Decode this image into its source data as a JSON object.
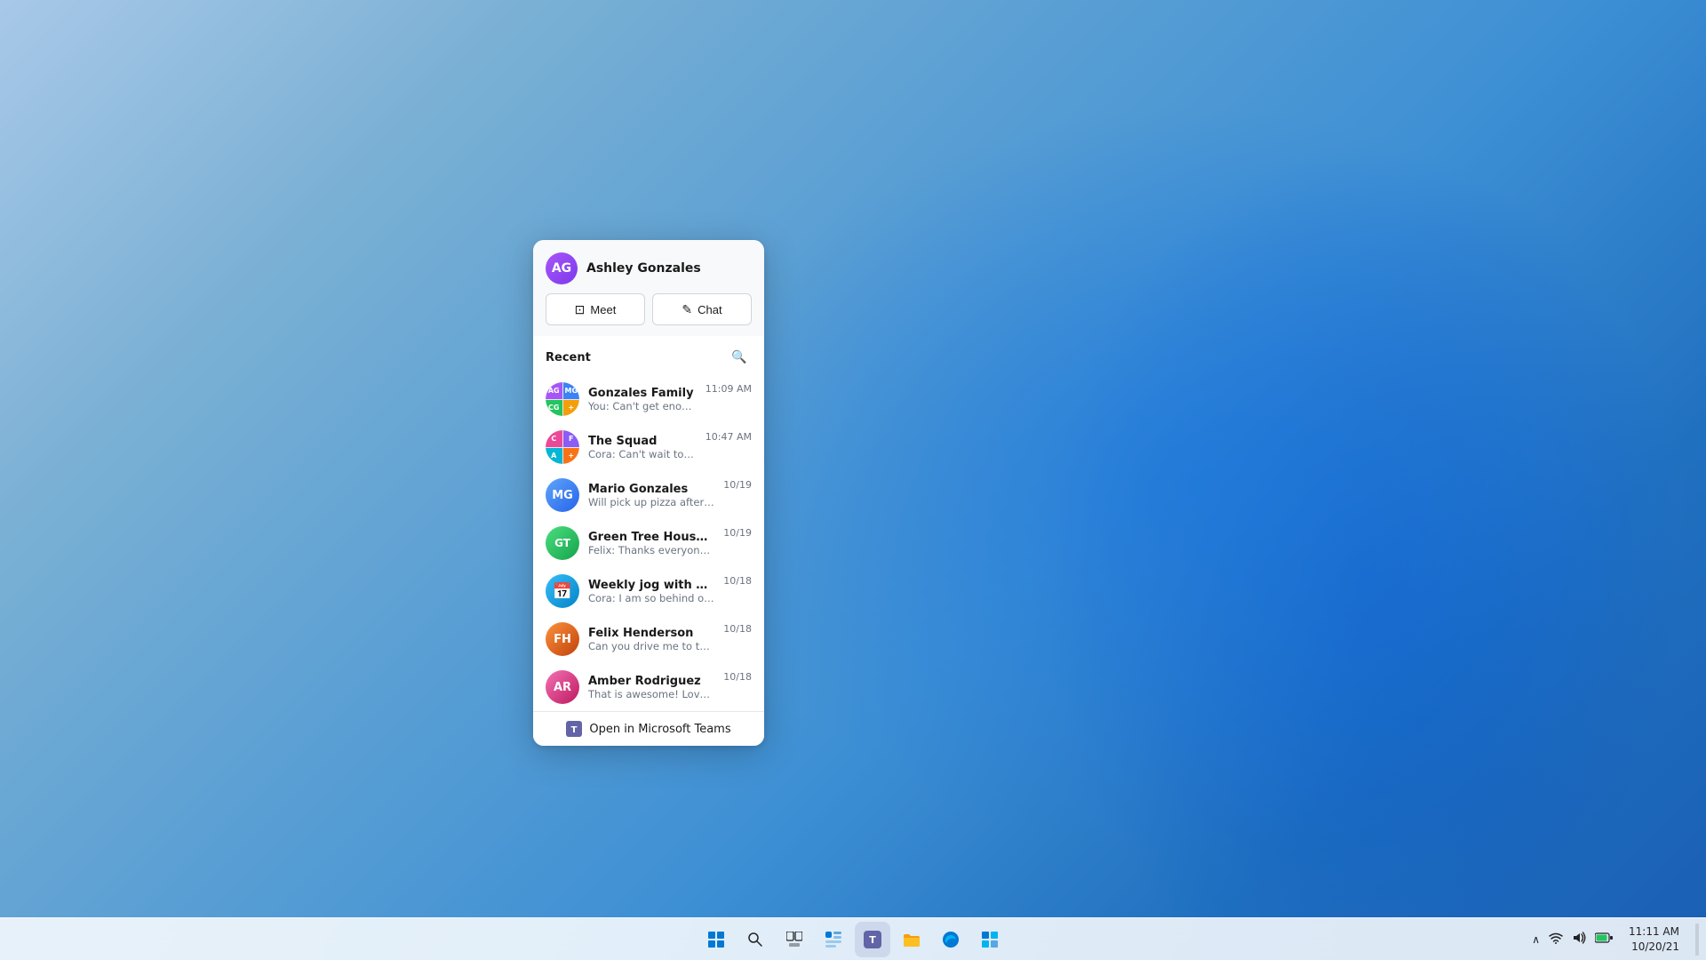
{
  "desktop": {
    "background_desc": "Windows 11 blue swirl wallpaper"
  },
  "chat_panel": {
    "user": {
      "name": "Ashley Gonzales",
      "avatar_initials": "AG"
    },
    "buttons": {
      "meet_label": "Meet",
      "chat_label": "Chat"
    },
    "recent_label": "Recent",
    "conversations": [
      {
        "id": 1,
        "name": "Gonzales Family",
        "preview": "You: Can't get enough of her.",
        "time": "11:09 AM",
        "type": "group",
        "avatar_color": "multi"
      },
      {
        "id": 2,
        "name": "The Squad",
        "preview": "Cora: Can't wait to see everyone!",
        "time": "10:47 AM",
        "type": "group",
        "avatar_color": "multi2"
      },
      {
        "id": 3,
        "name": "Mario Gonzales",
        "preview": "Will pick up pizza after my practice.",
        "time": "10/19",
        "type": "person",
        "avatar_color": "av-blue"
      },
      {
        "id": 4,
        "name": "Green Tree House PTA",
        "preview": "Felix: Thanks everyone for attending today.",
        "time": "10/19",
        "type": "initials",
        "avatar_color": "av-green2",
        "initials": "GT"
      },
      {
        "id": 5,
        "name": "Weekly jog with Cora",
        "preview": "Cora: I am so behind on my step goals.",
        "time": "10/18",
        "type": "calendar",
        "avatar_color": "av-teal"
      },
      {
        "id": 6,
        "name": "Felix Henderson",
        "preview": "Can you drive me to the PTA today?",
        "time": "10/18",
        "type": "person",
        "avatar_color": "av-orange"
      },
      {
        "id": 7,
        "name": "Amber Rodriguez",
        "preview": "That is awesome! Love it!",
        "time": "10/18",
        "type": "person",
        "avatar_color": "av-pink"
      }
    ],
    "open_teams_label": "Open in Microsoft Teams"
  },
  "taskbar": {
    "icons": [
      {
        "name": "windows-start",
        "symbol": "⊞"
      },
      {
        "name": "search",
        "symbol": "🔍"
      },
      {
        "name": "task-view",
        "symbol": "❑"
      },
      {
        "name": "widgets",
        "symbol": "▦"
      },
      {
        "name": "teams-chat",
        "symbol": "💬"
      },
      {
        "name": "file-explorer",
        "symbol": "📁"
      },
      {
        "name": "edge-browser",
        "symbol": "🌐"
      },
      {
        "name": "store",
        "symbol": "🛍"
      }
    ],
    "system_tray": {
      "overflow": "^",
      "wifi": "WiFi",
      "volume": "🔊",
      "battery": "🔋"
    },
    "clock": {
      "date": "10/20/21",
      "time": "11:11 AM"
    }
  }
}
